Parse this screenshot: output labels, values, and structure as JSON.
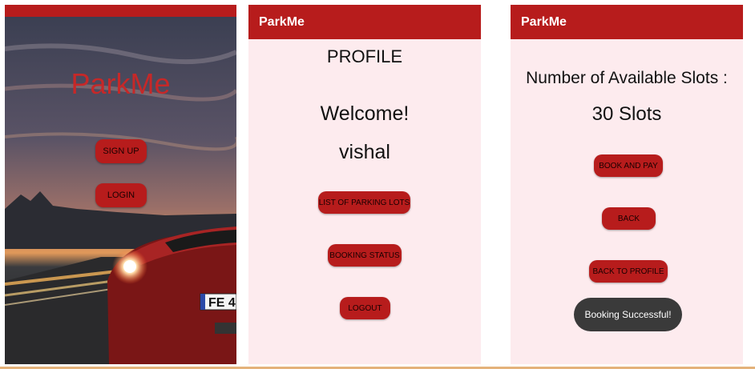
{
  "screen1": {
    "title": "ParkMe",
    "signup_label": "SIGN UP",
    "login_label": "LOGIN",
    "plate_text": "FE 4"
  },
  "screen2": {
    "appbar_title": "ParkMe",
    "heading": "PROFILE",
    "welcome": "Welcome!",
    "username": "vishal",
    "list_button": "LIST OF PARKING LOTS",
    "status_button": "BOOKING STATUS",
    "logout_button": "LOGOUT"
  },
  "screen3": {
    "appbar_title": "ParkMe",
    "slots_label": "Number of  Available Slots :",
    "slots_value": "30 Slots",
    "book_button": "BOOK AND PAY",
    "back_button": "BACK",
    "back_profile_button": "BACK TO PROFILE",
    "toast": "Booking Successful!"
  },
  "colors": {
    "accent": "#b71c1c",
    "background": "#fdebee",
    "title_red": "#c62828",
    "toast_bg": "#3a3a3a"
  }
}
